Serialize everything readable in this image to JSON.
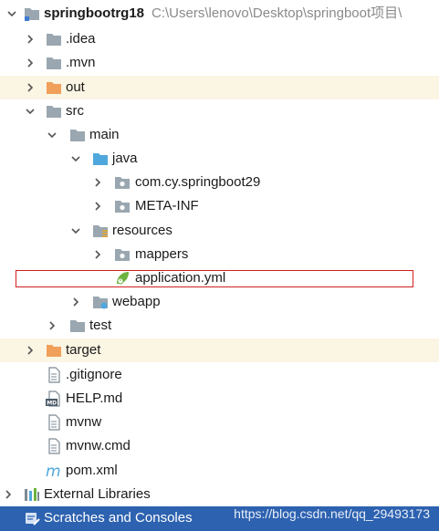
{
  "tree": {
    "root": {
      "name": "springbootrg18",
      "path": "C:\\Users\\lenovo\\Desktop\\springboot项目\\"
    },
    "idea": ".idea",
    "mvn": ".mvn",
    "out": "out",
    "src": "src",
    "main": "main",
    "java": "java",
    "pkg": "com.cy.springboot29",
    "metainf": "META-INF",
    "resources": "resources",
    "mappers": "mappers",
    "appyml": "application.yml",
    "webapp": "webapp",
    "test": "test",
    "target": "target",
    "gitignore": ".gitignore",
    "helpmd": "HELP.md",
    "mvnw": "mvnw",
    "mvnwcmd": "mvnw.cmd",
    "pom": "pom.xml",
    "extlibs": "External Libraries",
    "scratches": "Scratches and Consoles"
  },
  "watermark": "https://blog.csdn.net/qq_29493173",
  "colors": {
    "folder": "#9aa7b0",
    "excluded_folder": "#f0a05a",
    "source_folder": "#4fa8dc",
    "resources_folder": "#9aa7b0",
    "spring_leaf": "#6db33f",
    "selection_outline": "#d21f1f",
    "bottom_bar": "#2d62b0",
    "excluded_row_bg": "#fbf5e3"
  }
}
